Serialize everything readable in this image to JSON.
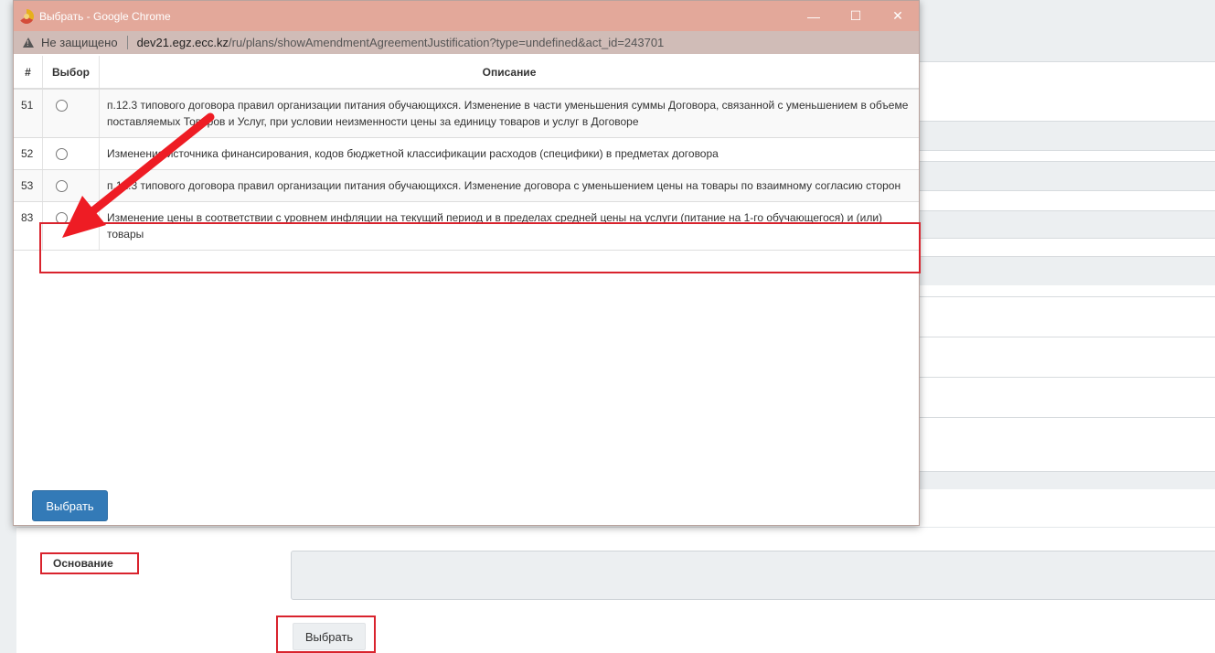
{
  "window": {
    "title": "Выбрать - Google Chrome",
    "security_label": "Не защищено",
    "url_host": "dev21.egz.ecc.kz",
    "url_path": "/ru/plans/showAmendmentAgreementJustification?type=undefined&act_id=243701",
    "minimize": "—",
    "maximize": "☐",
    "close": "✕"
  },
  "table": {
    "headers": {
      "num": "#",
      "select": "Выбор",
      "description": "Описание"
    },
    "rows": [
      {
        "num": "51",
        "description": "п.12.3 типового договора правил организации питания обучающихся. Изменение в части уменьшения суммы Договора, связанной с уменьшением в объеме поставляемых Товаров и Услуг, при условии неизменности цены за единицу товаров и услуг в Договоре"
      },
      {
        "num": "52",
        "description": "Изменение источника финансирования, кодов бюджетной классификации расходов (специфики) в предметах договора"
      },
      {
        "num": "53",
        "description": "п.12.3 типового договора правил организации питания обучающихся. Изменение договора с уменьшением цены на товары по взаимному согласию сторон"
      },
      {
        "num": "83",
        "description": "Изменение цены в соответствии с уровнем инфляции на текущий период и в пределах средней цены на услуги (питание на 1-го обучающегося) и (или) товары"
      }
    ]
  },
  "popup": {
    "select_button": "Выбрать"
  },
  "page": {
    "basis_label": "Основание",
    "select_button": "Выбрать"
  },
  "colors": {
    "annotation_red": "#d9232d",
    "primary_blue": "#337ab7",
    "titlebar": "#e3a89a"
  }
}
